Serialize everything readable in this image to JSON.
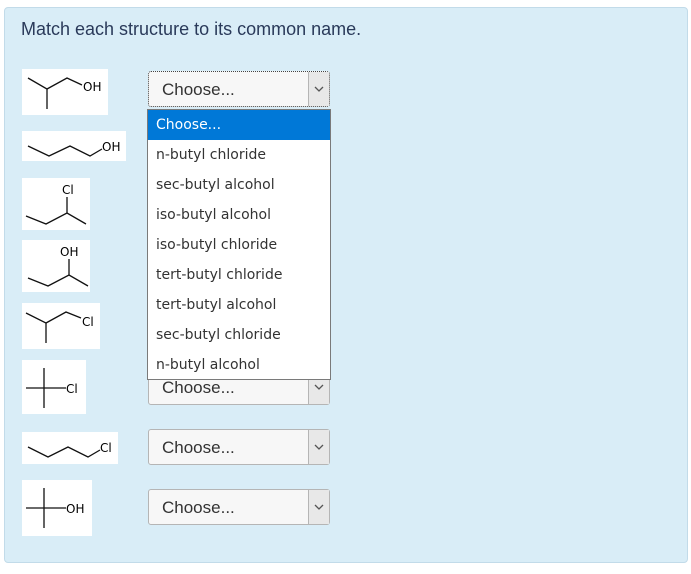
{
  "question": {
    "text": "Match each structure to its common name."
  },
  "structures": [
    {
      "label": "OH"
    },
    {
      "label": "OH"
    },
    {
      "label": "Cl"
    },
    {
      "label": "OH"
    },
    {
      "label": "Cl"
    },
    {
      "label": "Cl"
    },
    {
      "label": "Cl"
    },
    {
      "label": "OH"
    }
  ],
  "selects": [
    {
      "value": "Choose..."
    },
    {
      "value": "Choose..."
    },
    {
      "value": "Choose..."
    },
    {
      "value": "Choose..."
    }
  ],
  "dropdown": {
    "options": [
      "Choose...",
      "n-butyl chloride",
      "sec-butyl alcohol",
      "iso-butyl alcohol",
      "iso-butyl chloride",
      "tert-butyl chloride",
      "tert-butyl alcohol",
      "sec-butyl chloride",
      "n-butyl alcohol"
    ],
    "selected_index": 0
  },
  "colors": {
    "panel": "#d9edf7",
    "highlight": "#0078d7",
    "text": "#2a3a5a"
  },
  "icons": {
    "select_arrow": "chevron-down-icon"
  }
}
